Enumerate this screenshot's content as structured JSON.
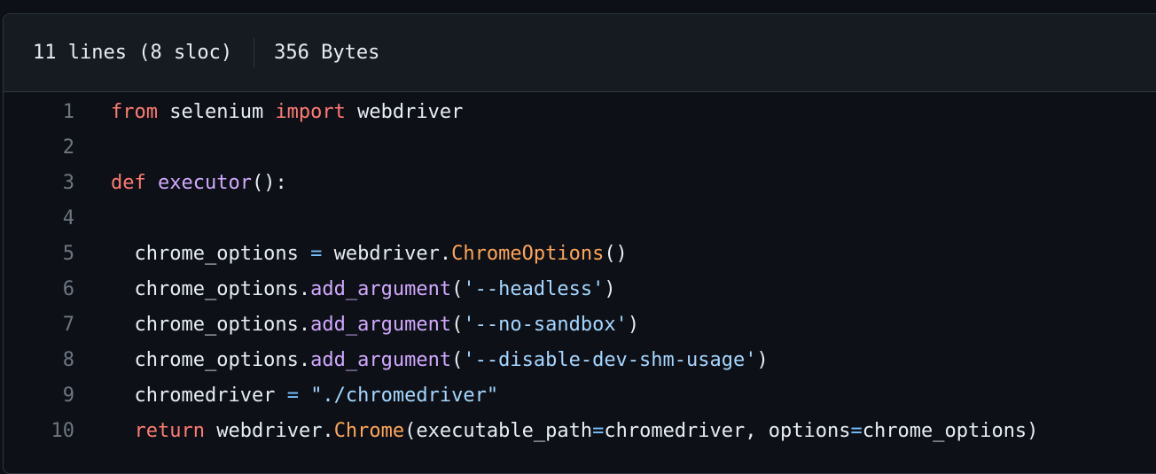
{
  "header": {
    "lines_info": "11 lines (8 sloc)",
    "size_info": "356 Bytes"
  },
  "code": {
    "line_numbers": [
      "1",
      "2",
      "3",
      "4",
      "5",
      "6",
      "7",
      "8",
      "9",
      "10"
    ],
    "lines": [
      [
        {
          "t": "from",
          "c": "kw"
        },
        {
          "t": " selenium "
        },
        {
          "t": "import",
          "c": "kw"
        },
        {
          "t": " webdriver"
        }
      ],
      [],
      [
        {
          "t": "def",
          "c": "kw"
        },
        {
          "t": " "
        },
        {
          "t": "executor",
          "c": "fn"
        },
        {
          "t": "():"
        }
      ],
      [],
      [
        {
          "t": "  chrome_options "
        },
        {
          "t": "=",
          "c": "op"
        },
        {
          "t": " webdriver."
        },
        {
          "t": "ChromeOptions",
          "c": "cls"
        },
        {
          "t": "()"
        }
      ],
      [
        {
          "t": "  chrome_options."
        },
        {
          "t": "add_argument",
          "c": "fn"
        },
        {
          "t": "("
        },
        {
          "t": "'--headless'",
          "c": "str"
        },
        {
          "t": ")"
        }
      ],
      [
        {
          "t": "  chrome_options."
        },
        {
          "t": "add_argument",
          "c": "fn"
        },
        {
          "t": "("
        },
        {
          "t": "'--no-sandbox'",
          "c": "str"
        },
        {
          "t": ")"
        }
      ],
      [
        {
          "t": "  chrome_options."
        },
        {
          "t": "add_argument",
          "c": "fn"
        },
        {
          "t": "("
        },
        {
          "t": "'--disable-dev-shm-usage'",
          "c": "str"
        },
        {
          "t": ")"
        }
      ],
      [
        {
          "t": "  chromedriver "
        },
        {
          "t": "=",
          "c": "op"
        },
        {
          "t": " "
        },
        {
          "t": "\"./chromedriver\"",
          "c": "str"
        }
      ],
      [
        {
          "t": "  "
        },
        {
          "t": "return",
          "c": "kw"
        },
        {
          "t": " webdriver."
        },
        {
          "t": "Chrome",
          "c": "cls"
        },
        {
          "t": "(executable_path"
        },
        {
          "t": "=",
          "c": "op"
        },
        {
          "t": "chromedriver, options"
        },
        {
          "t": "=",
          "c": "op"
        },
        {
          "t": "chrome_options)"
        }
      ]
    ]
  },
  "colors": {
    "background": "#0d1117",
    "header_background": "#161b22",
    "border": "#30363d",
    "keyword": "#ff7b72",
    "function": "#d2a8ff",
    "class": "#ffa657",
    "string": "#a5d6ff",
    "operator": "#79c0ff",
    "line_number": "#6e7681",
    "text": "#e6edf3"
  }
}
